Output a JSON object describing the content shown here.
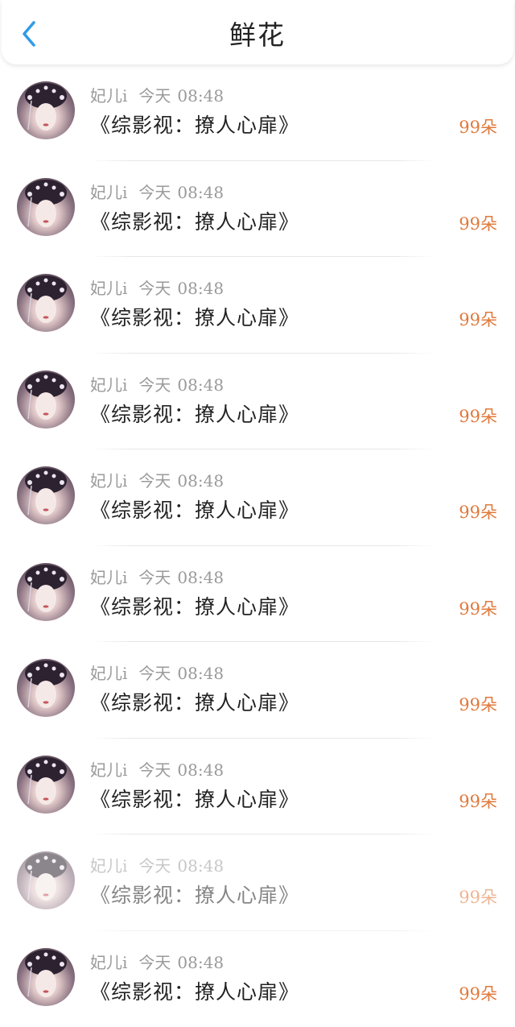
{
  "header": {
    "title": "鲜花",
    "back_icon": "chevron-left-icon",
    "accent_color": "#2f9be9"
  },
  "colors": {
    "count": "#e07a3c",
    "meta": "#9a9a9a",
    "text": "#222222"
  },
  "items": [
    {
      "user": "妃儿i",
      "day": "今天",
      "time": "08:48",
      "book": "《综影视：撩人心扉》",
      "count": "99朵"
    },
    {
      "user": "妃儿i",
      "day": "今天",
      "time": "08:48",
      "book": "《综影视：撩人心扉》",
      "count": "99朵"
    },
    {
      "user": "妃儿i",
      "day": "今天",
      "time": "08:48",
      "book": "《综影视：撩人心扉》",
      "count": "99朵"
    },
    {
      "user": "妃儿i",
      "day": "今天",
      "time": "08:48",
      "book": "《综影视：撩人心扉》",
      "count": "99朵"
    },
    {
      "user": "妃儿i",
      "day": "今天",
      "time": "08:48",
      "book": "《综影视：撩人心扉》",
      "count": "99朵"
    },
    {
      "user": "妃儿i",
      "day": "今天",
      "time": "08:48",
      "book": "《综影视：撩人心扉》",
      "count": "99朵"
    },
    {
      "user": "妃儿i",
      "day": "今天",
      "time": "08:48",
      "book": "《综影视：撩人心扉》",
      "count": "99朵"
    },
    {
      "user": "妃儿i",
      "day": "今天",
      "time": "08:48",
      "book": "《综影视：撩人心扉》",
      "count": "99朵"
    },
    {
      "user": "妃儿i",
      "day": "今天",
      "time": "08:48",
      "book": "《综影视：撩人心扉》",
      "count": "99朵"
    },
    {
      "user": "妃儿i",
      "day": "今天",
      "time": "08:48",
      "book": "《综影视：撩人心扉》",
      "count": "99朵"
    }
  ]
}
